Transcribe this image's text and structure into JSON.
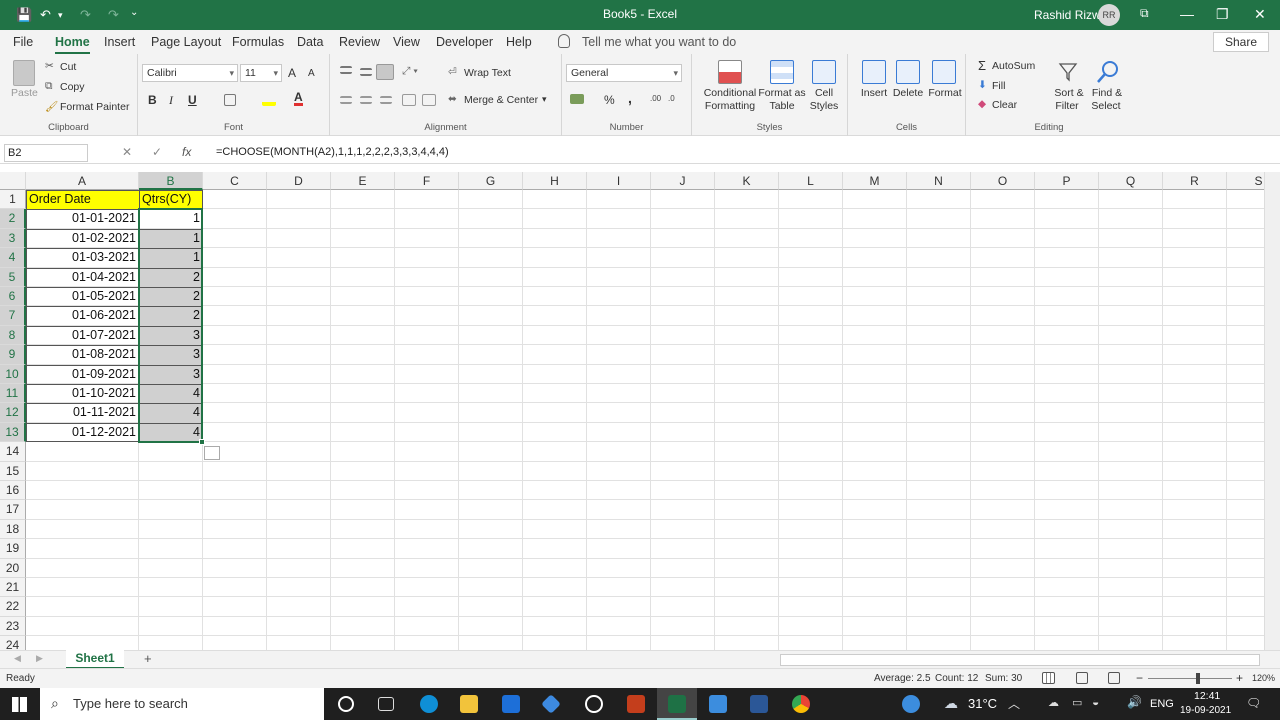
{
  "titlebar": {
    "title": "Book5 - Excel",
    "user": "Rashid Rizwi",
    "initials": "RR",
    "save_icon": "💾",
    "undo_icon": "↶",
    "redo_icon": "↷",
    "customize_icon": "⌄",
    "minimize": "—",
    "restore": "❐",
    "close": "✕",
    "ribbon_options_icon": "⧉"
  },
  "menu": {
    "tabs": [
      "File",
      "Home",
      "Insert",
      "Page Layout",
      "Formulas",
      "Data",
      "Review",
      "View",
      "Developer",
      "Help"
    ],
    "tellme": "Tell me what you want to do",
    "share": "Share"
  },
  "ribbon": {
    "clipboard": {
      "label": "Clipboard",
      "paste": "Paste",
      "cut": "Cut",
      "copy": "Copy",
      "painter": "Format Painter"
    },
    "font": {
      "label": "Font",
      "name": "Calibri",
      "size": "11",
      "bold": "B",
      "italic": "I",
      "underline": "U",
      "grow": "A",
      "shrink": "A"
    },
    "alignment": {
      "label": "Alignment",
      "wrap": "Wrap Text",
      "merge": "Merge & Center"
    },
    "number": {
      "label": "Number",
      "format": "General",
      "percent": "%",
      "comma": ","
    },
    "styles": {
      "label": "Styles",
      "cond1": "Conditional",
      "cond2": "Formatting",
      "fmt1": "Format as",
      "fmt2": "Table",
      "cell1": "Cell",
      "cell2": "Styles"
    },
    "cells": {
      "label": "Cells",
      "insert": "Insert",
      "delete": "Delete",
      "format": "Format"
    },
    "editing": {
      "label": "Editing",
      "autosum": "AutoSum",
      "fill": "Fill",
      "clear": "Clear",
      "sort1": "Sort &",
      "sort2": "Filter",
      "find1": "Find &",
      "find2": "Select"
    }
  },
  "formula_bar": {
    "name_box": "B2",
    "cancel": "✕",
    "enter": "✓",
    "fx": "fx",
    "formula": "=CHOOSE(MONTH(A2),1,1,1,2,2,2,3,3,3,4,4,4)"
  },
  "sheet": {
    "columns": [
      "A",
      "B",
      "C",
      "D",
      "E",
      "F",
      "G",
      "H",
      "I",
      "J",
      "K",
      "L",
      "M",
      "N",
      "O",
      "P",
      "Q",
      "R",
      "S"
    ],
    "rows": [
      "1",
      "2",
      "3",
      "4",
      "5",
      "6",
      "7",
      "8",
      "9",
      "10",
      "11",
      "12",
      "13",
      "14",
      "15",
      "16",
      "17",
      "18",
      "19",
      "20",
      "21",
      "22",
      "23",
      "24"
    ],
    "header_a": "Order Date",
    "header_b": "Qtrs(CY)",
    "dates": [
      "01-01-2021",
      "01-02-2021",
      "01-03-2021",
      "01-04-2021",
      "01-05-2021",
      "01-06-2021",
      "01-07-2021",
      "01-08-2021",
      "01-09-2021",
      "01-10-2021",
      "01-11-2021",
      "01-12-2021"
    ],
    "qtrs": [
      "1",
      "1",
      "1",
      "2",
      "2",
      "2",
      "3",
      "3",
      "3",
      "4",
      "4",
      "4"
    ]
  },
  "sheet_tabs": {
    "active": "Sheet1",
    "add": "+"
  },
  "status": {
    "ready": "Ready",
    "average": "Average: 2.5",
    "count": "Count: 12",
    "sum": "Sum: 30",
    "zoom": "120%",
    "zoom_minus": "−",
    "zoom_plus": "+",
    "zoom_level": 0.6
  },
  "taskbar": {
    "search": "Type here to search",
    "weather": "31°C",
    "lang": "ENG",
    "time": "12:41",
    "date": "19-09-2021"
  },
  "colors": {
    "excel_green": "#217346",
    "yellow": "#ffff00",
    "selection": "#d0d0d0"
  }
}
